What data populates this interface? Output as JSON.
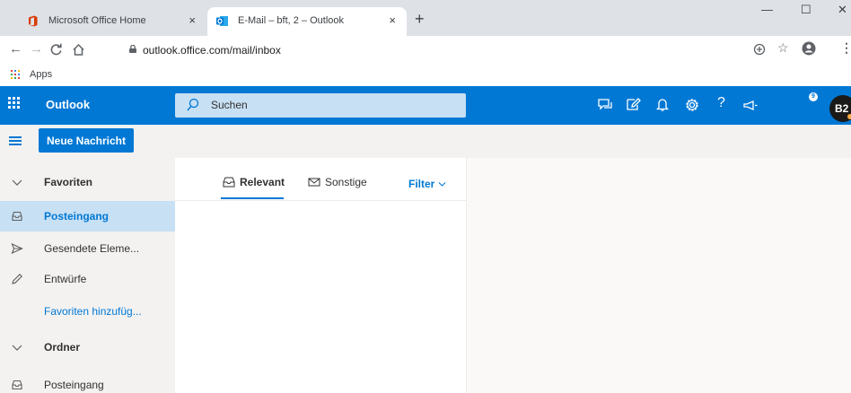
{
  "browser": {
    "tabs": [
      {
        "title": "Microsoft Office Home",
        "icon": "office-icon",
        "active": false
      },
      {
        "title": "E-Mail – bft, 2 – Outlook",
        "icon": "outlook-icon",
        "active": true
      }
    ],
    "tab_close_glyph": "×",
    "new_tab_glyph": "+",
    "window_controls": {
      "minimize": "—",
      "maximize": "☐",
      "close": "✕"
    },
    "url": "outlook.office.com/mail/inbox",
    "bookmarks": [
      {
        "label": "Apps",
        "icon": "apps-grid-icon"
      }
    ]
  },
  "outlook": {
    "app_name": "Outlook",
    "search": {
      "placeholder": "Suchen"
    },
    "header_icons": [
      "chat-icon",
      "edit-icon",
      "bell-icon",
      "gear-icon",
      "help-icon",
      "megaphone-icon"
    ],
    "notification_count": "9",
    "help_glyph": "?",
    "avatar_initials": "B2",
    "new_message_label": "Neue Nachricht",
    "nav": [
      {
        "label": "Favoriten",
        "type": "section",
        "icon": "chevron-down-icon"
      },
      {
        "label": "Posteingang",
        "type": "folder",
        "selected": true,
        "icon": "inbox-icon"
      },
      {
        "label": "Gesendete Eleme...",
        "type": "folder",
        "icon": "send-icon"
      },
      {
        "label": "Entwürfe",
        "type": "folder",
        "icon": "pencil-icon"
      },
      {
        "label": "Favoriten hinzufüg...",
        "type": "link",
        "icon": ""
      },
      {
        "label": "Ordner",
        "type": "section",
        "icon": "chevron-down-icon"
      },
      {
        "label": "Posteingang",
        "type": "folder",
        "icon": "inbox-icon"
      }
    ],
    "pivots": [
      {
        "label": "Relevant",
        "active": true,
        "icon": "inbox-tray-icon"
      },
      {
        "label": "Sonstige",
        "active": false,
        "icon": "envelope-icon"
      }
    ],
    "filter_label": "Filter"
  },
  "colors": {
    "accent": "#0078d4",
    "selected_bg": "#c7e0f4",
    "nav_bg": "#f3f2f1",
    "tabstrip_bg": "#dee1e6"
  }
}
